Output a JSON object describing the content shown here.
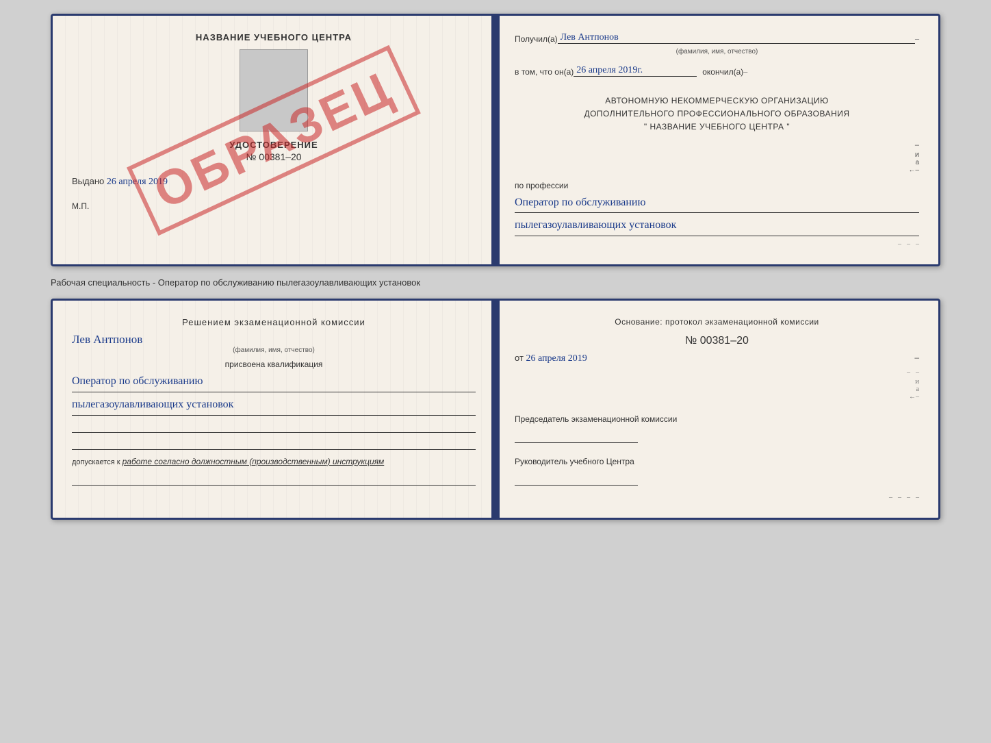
{
  "page": {
    "background": "#d0d0d0"
  },
  "top_document": {
    "left_page": {
      "title": "НАЗВАНИЕ УЧЕБНОГО ЦЕНТРА",
      "cert_label": "УДОСТОВЕРЕНИЕ",
      "cert_number": "№ 00381–20",
      "issued_prefix": "Выдано",
      "issued_date": "26 апреля 2019",
      "mp_label": "М.П.",
      "stamp_text": "ОБРАЗЕЦ"
    },
    "right_page": {
      "received_label": "Получил(а)",
      "recipient_name": "Лев Антпонов",
      "fio_subtext": "(фамилия, имя, отчество)",
      "in_that_prefix": "в том, что он(а)",
      "completion_date": "26 апреля 2019г.",
      "completed_label": "окончил(а)",
      "org_line1": "АВТОНОМНУЮ НЕКОММЕРЧЕСКУЮ ОРГАНИЗАЦИЮ",
      "org_line2": "ДОПОЛНИТЕЛЬНОГО ПРОФЕССИОНАЛЬНОГО ОБРАЗОВАНИЯ",
      "org_line3": "\"   НАЗВАНИЕ УЧЕБНОГО ЦЕНТРА   \"",
      "profession_prefix": "по профессии",
      "profession_line1": "Оператор по обслуживанию",
      "profession_line2": "пылегазоулавливающих установок"
    }
  },
  "subtitle": "Рабочая специальность - Оператор по обслуживанию пылегазоулавливающих установок",
  "bottom_document": {
    "left_page": {
      "decision_prefix": "Решением экзаменационной комиссии",
      "recipient_name": "Лев Антпонов",
      "fio_subtext": "(фамилия, имя, отчество)",
      "assigned_label": "присвоена квалификация",
      "qualification_line1": "Оператор по обслуживанию",
      "qualification_line2": "пылегазоулавливающих установок",
      "allowed_prefix": "допускается к",
      "allowed_value": "работе согласно должностным (производственным) инструкциям"
    },
    "right_page": {
      "basis_label": "Основание: протокол экзаменационной комиссии",
      "protocol_number": "№ 00381–20",
      "date_prefix": "от",
      "date_value": "26 апреля 2019",
      "commission_chair_title": "Председатель экзаменационной комиссии",
      "education_head_title": "Руководитель учебного Центра"
    }
  }
}
